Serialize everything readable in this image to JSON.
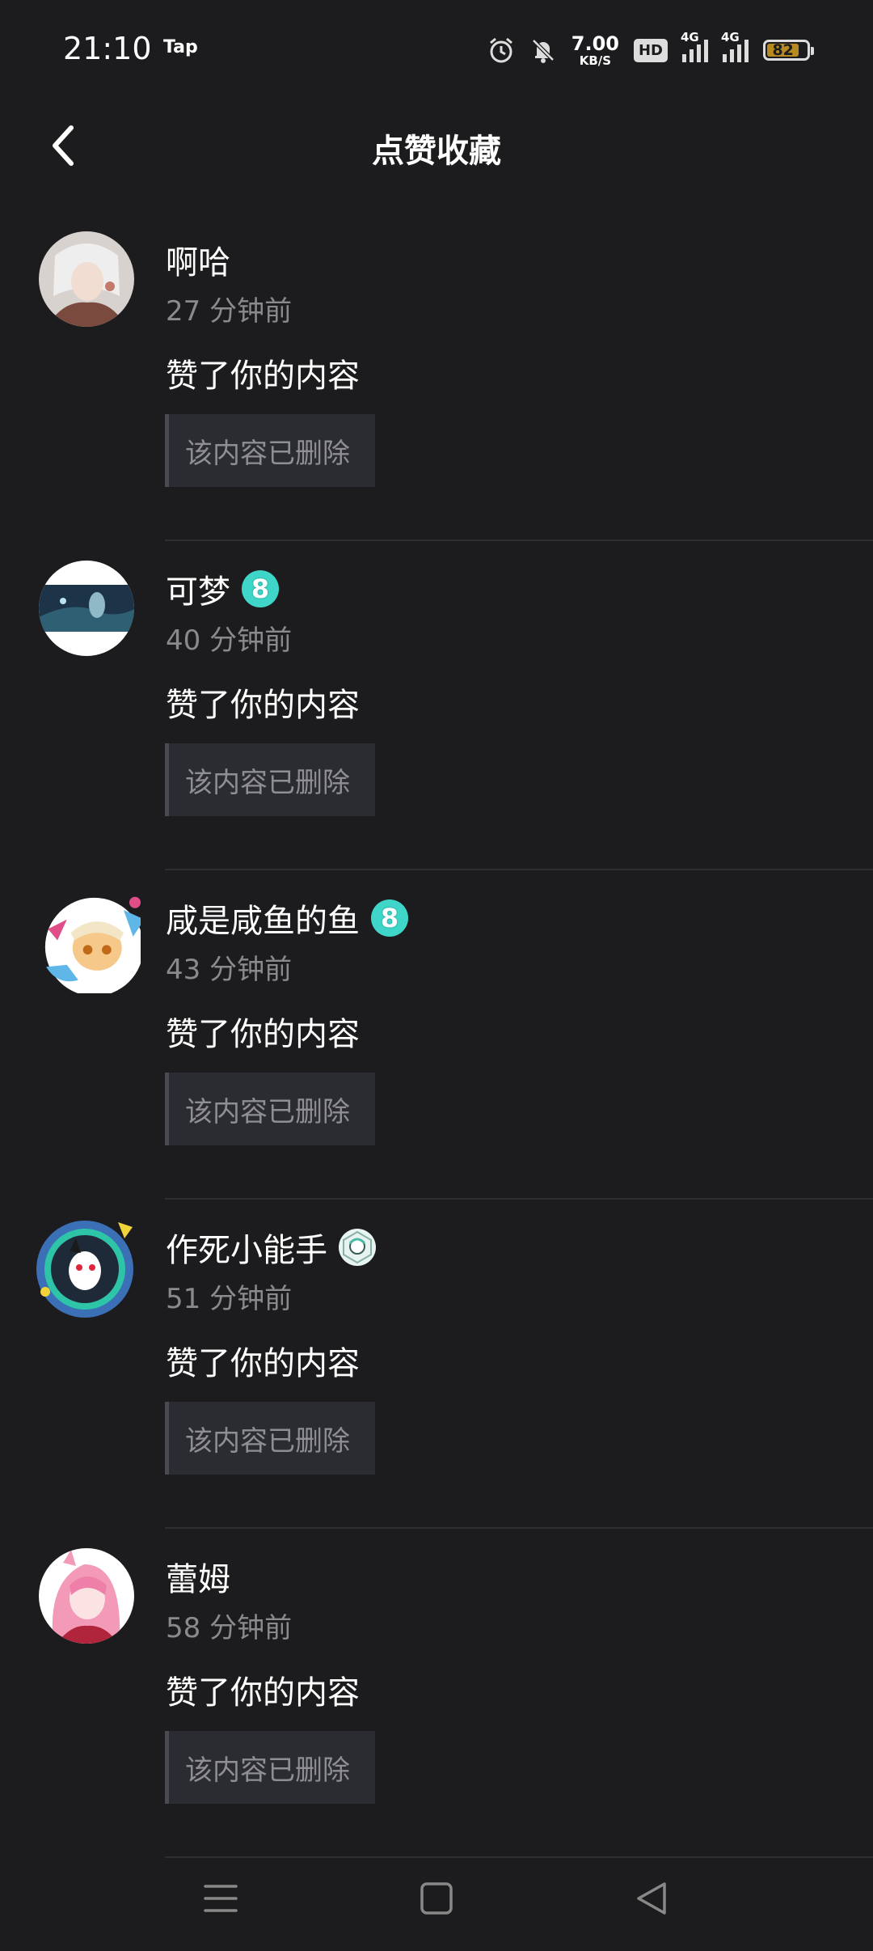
{
  "status_bar": {
    "time": "21:10",
    "app_label": "Tap",
    "net_speed_value": "7.00",
    "net_speed_unit": "KB/S",
    "hd_label": "HD",
    "signal1_label": "4G",
    "signal2_label": "4G",
    "battery_level": "82",
    "battery_color": "#b68a1f"
  },
  "header": {
    "title": "点赞收藏",
    "back_icon": "chevron-left-icon"
  },
  "notifications": [
    {
      "name": "啊哈",
      "time": "27 分钟前",
      "action": "赞了你的内容",
      "content": "该内容已删除",
      "badge": null
    },
    {
      "name": "可梦",
      "time": "40 分钟前",
      "action": "赞了你的内容",
      "content": "该内容已删除",
      "badge": "8"
    },
    {
      "name": "咸是咸鱼的鱼",
      "time": "43 分钟前",
      "action": "赞了你的内容",
      "content": "该内容已删除",
      "badge": "8"
    },
    {
      "name": "作死小能手",
      "time": "51 分钟前",
      "action": "赞了你的内容",
      "content": "该内容已删除",
      "badge": "avatar-badge-icon"
    },
    {
      "name": "蕾姆",
      "time": "58 分钟前",
      "action": "赞了你的内容",
      "content": "该内容已删除",
      "badge": null
    }
  ],
  "nav_bar": {
    "icons": [
      "menu-icon",
      "home-icon",
      "back-icon"
    ]
  },
  "colors": {
    "background": "#1c1c1e",
    "secondary_text": "#8a8a8e",
    "level_badge": "#3fd6c9"
  }
}
